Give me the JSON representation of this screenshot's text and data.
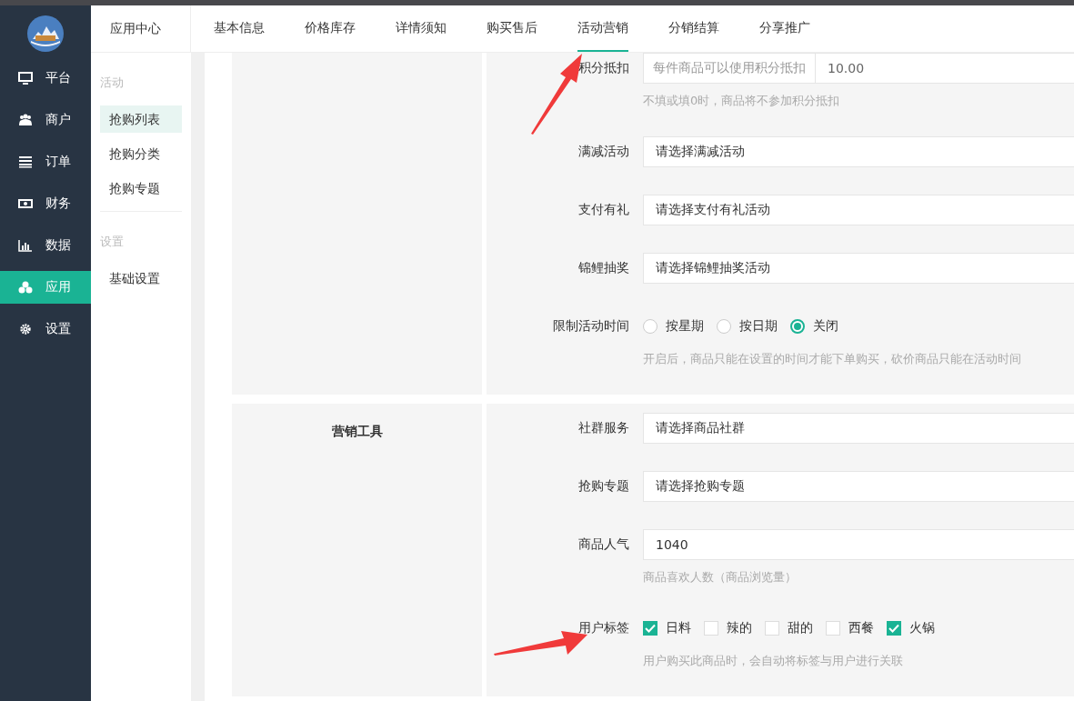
{
  "nav": {
    "items": [
      {
        "label": "平台",
        "selected": false
      },
      {
        "label": "商户",
        "selected": false
      },
      {
        "label": "订单",
        "selected": false
      },
      {
        "label": "财务",
        "selected": false
      },
      {
        "label": "数据",
        "selected": false
      },
      {
        "label": "应用",
        "selected": true
      },
      {
        "label": "设置",
        "selected": false
      }
    ]
  },
  "subnav": {
    "title": "应用中心",
    "groups": [
      {
        "heading": "活动",
        "items": [
          {
            "label": "抢购列表",
            "selected": true
          },
          {
            "label": "抢购分类",
            "selected": false
          },
          {
            "label": "抢购专题",
            "selected": false
          }
        ]
      },
      {
        "heading": "设置",
        "items": [
          {
            "label": "基础设置",
            "selected": false
          }
        ]
      }
    ]
  },
  "tabs": [
    {
      "label": "基本信息",
      "selected": false
    },
    {
      "label": "价格库存",
      "selected": false
    },
    {
      "label": "详情须知",
      "selected": false
    },
    {
      "label": "购买售后",
      "selected": false
    },
    {
      "label": "活动营销",
      "selected": true
    },
    {
      "label": "分销结算",
      "selected": false
    },
    {
      "label": "分享推广",
      "selected": false
    }
  ],
  "sections": [
    {
      "fields": [
        {
          "kind": "addon",
          "label": "积分抵扣",
          "prefix": "每件商品可以使用积分抵扣",
          "value": "10.00",
          "hint": "不填或填0时，商品将不参加积分抵扣"
        },
        {
          "kind": "select",
          "label": "满减活动",
          "value": "请选择满减活动"
        },
        {
          "kind": "select",
          "label": "支付有礼",
          "value": "请选择支付有礼活动"
        },
        {
          "kind": "select",
          "label": "锦鲤抽奖",
          "value": "请选择锦鲤抽奖活动"
        },
        {
          "kind": "radio",
          "label": "限制活动时间",
          "options": [
            {
              "label": "按星期",
              "selected": false
            },
            {
              "label": "按日期",
              "selected": false
            },
            {
              "label": "关闭",
              "selected": true
            }
          ],
          "hint": "开启后，商品只能在设置的时间才能下单购买，砍价商品只能在活动时间"
        }
      ]
    },
    {
      "title": "营销工具",
      "fields": [
        {
          "kind": "select",
          "label": "社群服务",
          "value": "请选择商品社群"
        },
        {
          "kind": "select",
          "label": "抢购专题",
          "value": "请选择抢购专题"
        },
        {
          "kind": "text",
          "label": "商品人气",
          "value": "1040",
          "hint": "商品喜欢人数（商品浏览量）"
        },
        {
          "kind": "checkbox",
          "label": "用户标签",
          "options": [
            {
              "label": "日料",
              "checked": true
            },
            {
              "label": "辣的",
              "checked": false
            },
            {
              "label": "甜的",
              "checked": false
            },
            {
              "label": "西餐",
              "checked": false
            },
            {
              "label": "火锅",
              "checked": true
            }
          ],
          "hint": "用户购买此商品时，会自动将标签与用户进行关联"
        }
      ]
    }
  ]
}
